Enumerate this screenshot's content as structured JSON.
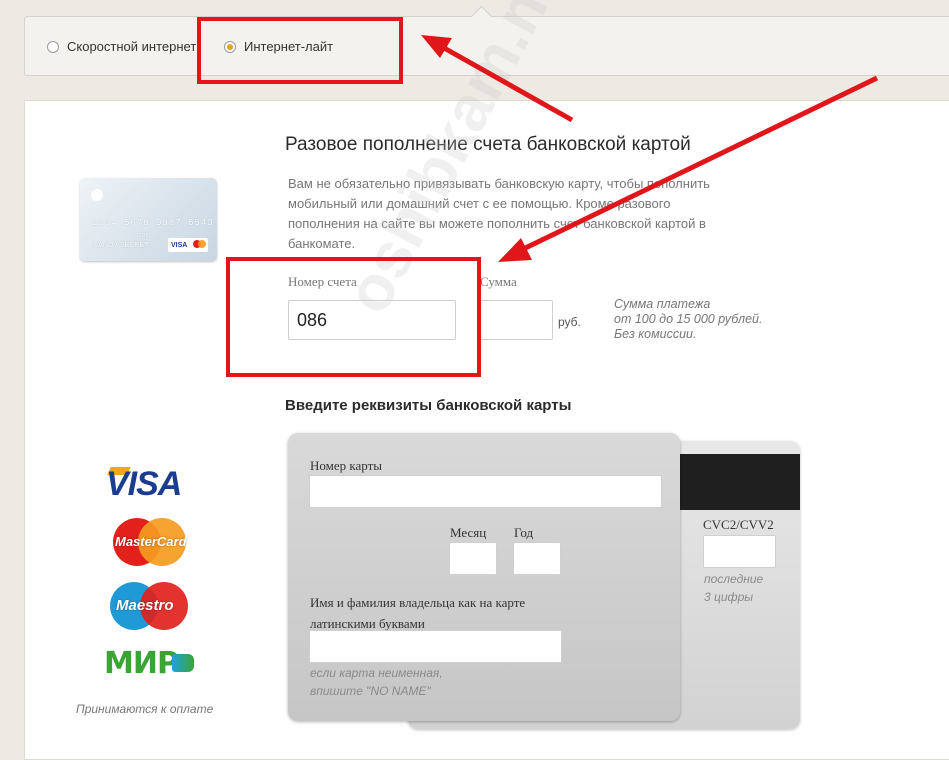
{
  "tariffs": {
    "options": [
      {
        "label": "Скоростной интернет",
        "selected": false
      },
      {
        "label": "Интернет-лайт",
        "selected": true
      }
    ]
  },
  "topup": {
    "title": "Разовое пополнение счета банковской картой",
    "description": "Вам не обязательно привязывать банковскую карту, чтобы пополнить мобильный или домашний счет с ее помощью. Кроме разового пополнения на сайте вы можете пополнить счет банковской картой в банкомате.",
    "account_label": "Номер счета",
    "account_value": "086",
    "amount_label": "Сумма",
    "amount_value": "",
    "currency": "руб.",
    "note": [
      "Сумма платежа",
      "от 100 до 15 000 рублей.",
      "Без комиссии."
    ]
  },
  "card_image": {
    "number": "1234 5678 9987 6543",
    "date": "12/18",
    "holder": "IVANOV SECRET",
    "brand": "VISA"
  },
  "card_form": {
    "title": "Введите реквизиты банковской карты",
    "card_number_label": "Номер карты",
    "month_label": "Месяц",
    "year_label": "Год",
    "holder_label_1": "Имя и фамилия владельца как на карте",
    "holder_label_2": "латинскими буквами",
    "holder_hint_1": "если карта неименная,",
    "holder_hint_2": "впишите \"NO NAME\"",
    "cvc_label": "CVC2/CVV2",
    "cvc_hint_1": "последние",
    "cvc_hint_2": "3 цифры"
  },
  "payment_logos": {
    "visa": "VISA",
    "mastercard": "MasterCard",
    "maestro": "Maestro",
    "mir": "МИР",
    "accepted": "Принимаются к оплате"
  },
  "colors": {
    "accent_red": "#e0161b",
    "radio_selected": "#e7a31c",
    "visa_blue": "#1a3d8f",
    "mir_green": "#3aa535"
  },
  "watermark": "oshibkam.net"
}
